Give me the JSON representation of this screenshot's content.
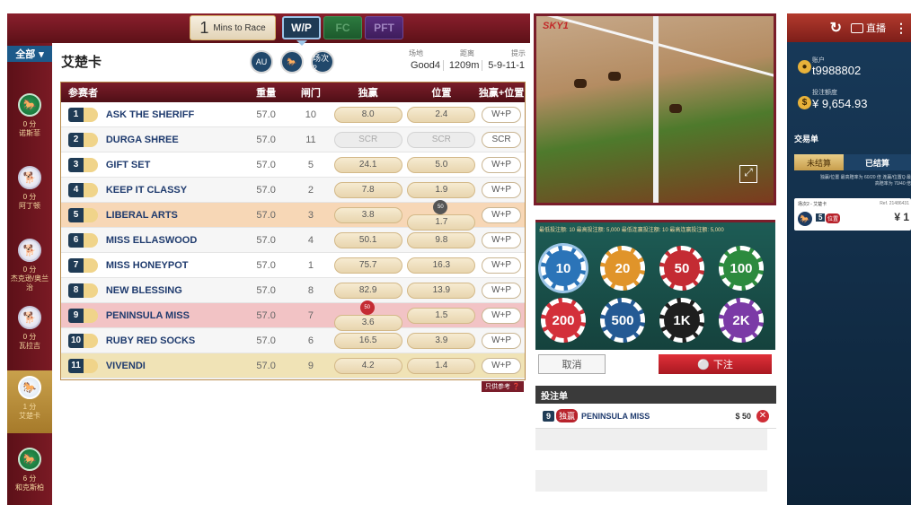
{
  "topbar": {
    "timer_num": "1",
    "timer_label": "Mins to Race",
    "tabs": [
      "W/P",
      "FC",
      "PFT"
    ]
  },
  "sidebar": {
    "all_label": "全部",
    "races": [
      {
        "mins": "0 分",
        "name": "诺斯菲",
        "type": "horse"
      },
      {
        "mins": "0 分",
        "name": "阿丁顿",
        "type": "greyhound"
      },
      {
        "mins": "0 分",
        "name": "杰克逊/奥兰治",
        "type": "greyhound"
      },
      {
        "mins": "0 分",
        "name": "瓦拉吉",
        "type": "greyhound"
      },
      {
        "mins": "1 分",
        "name": "艾楚卡",
        "type": "active"
      },
      {
        "mins": "6 分",
        "name": "和克斯柏",
        "type": "horse"
      }
    ]
  },
  "race": {
    "title": "艾楚卡",
    "badges": [
      "AU",
      "",
      "场次 2"
    ],
    "info_labels": [
      "场地",
      "距离",
      "提示"
    ],
    "info_values": [
      "Good4",
      "1209m",
      "5-9-11-1"
    ]
  },
  "table": {
    "headers": [
      "参赛者",
      "重量",
      "闸门",
      "独赢",
      "位置",
      "独赢+位置"
    ],
    "rows": [
      {
        "num": "1",
        "name": "ASK THE SHERIFF",
        "wt": "57.0",
        "draw": "10",
        "win": "8.0",
        "place": "2.4",
        "wp": "W+P",
        "hl": ""
      },
      {
        "num": "2",
        "name": "DURGA SHREE",
        "wt": "57.0",
        "draw": "11",
        "win": "SCR",
        "place": "SCR",
        "wp": "SCR",
        "hl": "scr"
      },
      {
        "num": "3",
        "name": "GIFT SET",
        "wt": "57.0",
        "draw": "5",
        "win": "24.1",
        "place": "5.0",
        "wp": "W+P",
        "hl": ""
      },
      {
        "num": "4",
        "name": "KEEP IT CLASSY",
        "wt": "57.0",
        "draw": "2",
        "win": "7.8",
        "place": "1.9",
        "wp": "W+P",
        "hl": ""
      },
      {
        "num": "5",
        "name": "LIBERAL ARTS",
        "wt": "57.0",
        "draw": "3",
        "win": "3.8",
        "place": "1.7",
        "wp": "W+P",
        "hl": "orange"
      },
      {
        "num": "6",
        "name": "MISS ELLASWOOD",
        "wt": "57.0",
        "draw": "4",
        "win": "50.1",
        "place": "9.8",
        "wp": "W+P",
        "hl": ""
      },
      {
        "num": "7",
        "name": "MISS HONEYPOT",
        "wt": "57.0",
        "draw": "1",
        "win": "75.7",
        "place": "16.3",
        "wp": "W+P",
        "hl": ""
      },
      {
        "num": "8",
        "name": "NEW BLESSING",
        "wt": "57.0",
        "draw": "8",
        "win": "82.9",
        "place": "13.9",
        "wp": "W+P",
        "hl": ""
      },
      {
        "num": "9",
        "name": "PENINSULA MISS",
        "wt": "57.0",
        "draw": "7",
        "win": "3.6",
        "place": "1.5",
        "wp": "W+P",
        "hl": "red"
      },
      {
        "num": "10",
        "name": "RUBY RED SOCKS",
        "wt": "57.0",
        "draw": "6",
        "win": "16.5",
        "place": "3.9",
        "wp": "W+P",
        "hl": ""
      },
      {
        "num": "11",
        "name": "VIVENDI",
        "wt": "57.0",
        "draw": "9",
        "win": "4.2",
        "place": "1.4",
        "wp": "W+P",
        "hl": "gold"
      }
    ],
    "note": "只供参考"
  },
  "video": {
    "channel": "SKY1"
  },
  "bet": {
    "limit_text": "最低投注额: 10  最高投注额: 5,000  最低连赢投注额: 10  最高连赢投注额: 5,000",
    "chips": [
      {
        "label": "10",
        "color": "#2b74b8"
      },
      {
        "label": "20",
        "color": "#e0942a"
      },
      {
        "label": "50",
        "color": "#c42b33"
      },
      {
        "label": "100",
        "color": "#2c8a3e"
      },
      {
        "label": "200",
        "color": "#d3303a"
      },
      {
        "label": "500",
        "color": "#245a94"
      },
      {
        "label": "1K",
        "color": "#1e1e1e"
      },
      {
        "label": "2K",
        "color": "#7b3aa6"
      }
    ],
    "cancel": "取消",
    "place": "下注"
  },
  "betslip": {
    "title": "投注单",
    "item": {
      "num": "9",
      "type": "独赢",
      "name": "PENINSULA MISS",
      "amount": "$ 50"
    }
  },
  "account": {
    "live": "直播",
    "account_label": "账户",
    "account_id": "t9988802",
    "balance_label": "投注额度",
    "balance": "¥ 9,654.93",
    "txn_title": "交易单",
    "tab_unsettled": "未结算",
    "tab_settled": "已结算",
    "limit_note": "独赢/位置 最高赔率为 60/20 倍 连赢/位置Q 最高赔率为 70/40 倍",
    "ticket_race": "场次2 - 艾楚卡",
    "ticket_ref": "Ref. 21486431",
    "ticket_num": "5",
    "ticket_type": "位置",
    "ticket_amount": "¥ 1"
  }
}
